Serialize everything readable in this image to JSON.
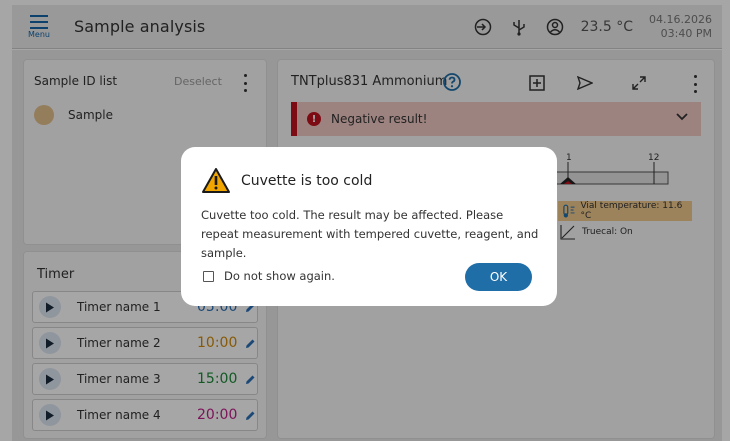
{
  "header": {
    "menu_label": "Menu",
    "title": "Sample analysis",
    "temperature": "23.5 °C",
    "date": "04.16.2026",
    "time": "03:40 PM",
    "icons": [
      "login-icon",
      "usb-icon",
      "user-icon"
    ]
  },
  "sample_list": {
    "title": "Sample ID list",
    "deselect_label": "Deselect",
    "items": [
      {
        "label": "Sample",
        "color": "#e3c08b"
      }
    ]
  },
  "timers": {
    "title": "Timer",
    "items": [
      {
        "name": "Timer name 1",
        "value": "05:00",
        "color": "#2a6fb5"
      },
      {
        "name": "Timer name 2",
        "value": "10:00",
        "color": "#d08a0a"
      },
      {
        "name": "Timer name 3",
        "value": "15:00",
        "color": "#1e8a3a"
      },
      {
        "name": "Timer name 4",
        "value": "20:00",
        "color": "#c0208a"
      }
    ]
  },
  "test": {
    "title": "TNTplus831 Ammonium",
    "banner": "Negative result!",
    "scale_min": "1",
    "scale_max": "12",
    "vial_temperature": "Vial temperature: 11.6 °C",
    "truecal": "Truecal: On"
  },
  "dialog": {
    "title": "Cuvette is too cold",
    "message": "Cuvette too cold. The result may be affected. Please repeat measurement with tempered cuvette, reagent, and sample.",
    "checkbox_label": "Do not show again.",
    "ok_label": "OK"
  },
  "colors": {
    "accent": "#1f6ea8",
    "error": "#c1121f",
    "error_bg": "#f2c9c5",
    "warning": "#f0a500"
  }
}
